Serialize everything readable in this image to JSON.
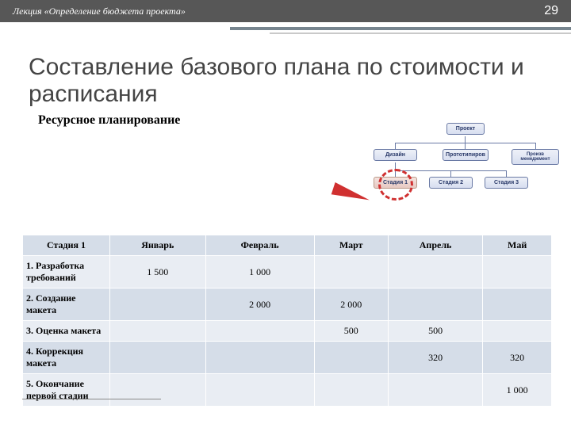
{
  "header": {
    "title": "Лекция «Определение бюджета проекта»",
    "page": "29"
  },
  "slide": {
    "title": "Составление базового плана по стоимости и расписания",
    "subtitle": "Ресурсное планирование"
  },
  "diagram": {
    "root": "Проект",
    "level2": [
      "Дизайн",
      "Прототипиров",
      "Произв менеджмент"
    ],
    "level3": [
      "Стадия 1",
      "Стадия 2",
      "Стадия 3"
    ]
  },
  "table": {
    "headers": [
      "Стадия 1",
      "Январь",
      "Февраль",
      "Март",
      "Апрель",
      "Май"
    ],
    "rows": [
      {
        "label": "1. Разработка требований",
        "cells": [
          "1 500",
          "1 000",
          "",
          "",
          ""
        ]
      },
      {
        "label": "2. Создание макета",
        "cells": [
          "",
          "2 000",
          "2 000",
          "",
          ""
        ]
      },
      {
        "label": "3. Оценка макета",
        "cells": [
          "",
          "",
          "500",
          "500",
          ""
        ]
      },
      {
        "label": "4. Коррекция макета",
        "cells": [
          "",
          "",
          "",
          "320",
          "320"
        ]
      },
      {
        "label": "5. Окончание первой стадии",
        "cells": [
          "",
          "",
          "",
          "",
          "1 000"
        ]
      }
    ]
  },
  "chart_data": {
    "type": "table",
    "title": "Ресурсное планирование — Стадия 1",
    "categories": [
      "Январь",
      "Февраль",
      "Март",
      "Апрель",
      "Май"
    ],
    "series": [
      {
        "name": "1. Разработка требований",
        "values": [
          1500,
          1000,
          null,
          null,
          null
        ]
      },
      {
        "name": "2. Создание макета",
        "values": [
          null,
          2000,
          2000,
          null,
          null
        ]
      },
      {
        "name": "3. Оценка макета",
        "values": [
          null,
          null,
          500,
          500,
          null
        ]
      },
      {
        "name": "4. Коррекция макета",
        "values": [
          null,
          null,
          null,
          320,
          320
        ]
      },
      {
        "name": "5. Окончание первой стадии",
        "values": [
          null,
          null,
          null,
          null,
          1000
        ]
      }
    ]
  }
}
